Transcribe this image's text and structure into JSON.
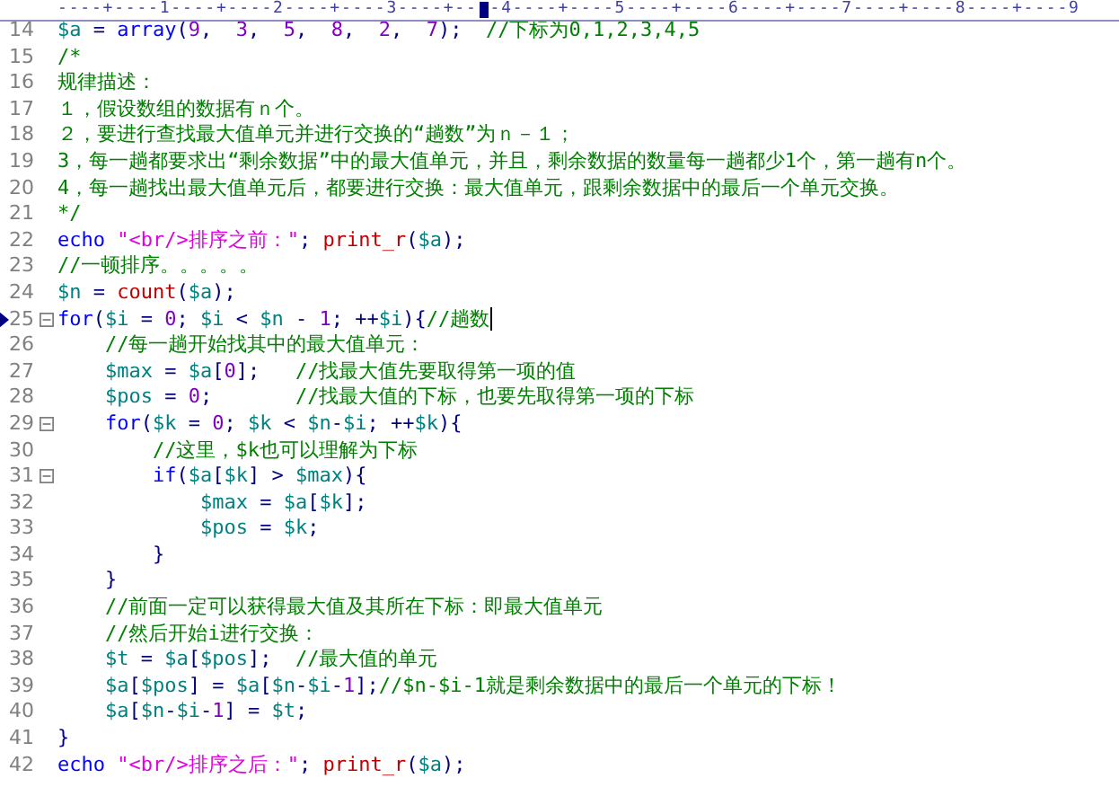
{
  "ruler": {
    "left": "----+----1----+----2----+----3----+--",
    "right": "-4----+----5----+----6----+----7----+----8----+----9"
  },
  "lines": [
    {
      "number": "14",
      "fold": false,
      "bookmark": false,
      "caret": false,
      "tokens": [
        {
          "kind": "var",
          "text": "$a"
        },
        {
          "kind": "op",
          "text": " = "
        },
        {
          "kind": "kw",
          "text": "array"
        },
        {
          "kind": "op",
          "text": "("
        },
        {
          "kind": "num",
          "text": "9"
        },
        {
          "kind": "op",
          "text": ",  "
        },
        {
          "kind": "num",
          "text": "3"
        },
        {
          "kind": "op",
          "text": ",  "
        },
        {
          "kind": "num",
          "text": "5"
        },
        {
          "kind": "op",
          "text": ",  "
        },
        {
          "kind": "num",
          "text": "8"
        },
        {
          "kind": "op",
          "text": ",  "
        },
        {
          "kind": "num",
          "text": "2"
        },
        {
          "kind": "op",
          "text": ",  "
        },
        {
          "kind": "num",
          "text": "7"
        },
        {
          "kind": "op",
          "text": ");  "
        },
        {
          "kind": "cmt",
          "text": "//下标为0,1,2,3,4,5"
        }
      ]
    },
    {
      "number": "15",
      "fold": false,
      "bookmark": false,
      "caret": false,
      "tokens": [
        {
          "kind": "cmt",
          "text": "/*"
        }
      ]
    },
    {
      "number": "16",
      "fold": false,
      "bookmark": false,
      "caret": false,
      "tokens": [
        {
          "kind": "cmt",
          "text": "规律描述："
        }
      ]
    },
    {
      "number": "17",
      "fold": false,
      "bookmark": false,
      "caret": false,
      "tokens": [
        {
          "kind": "cmt",
          "text": "１，假设数组的数据有ｎ个。"
        }
      ]
    },
    {
      "number": "18",
      "fold": false,
      "bookmark": false,
      "caret": false,
      "tokens": [
        {
          "kind": "cmt",
          "text": "２，要进行查找最大值单元并进行交换的“趟数”为ｎ－１；"
        }
      ]
    },
    {
      "number": "19",
      "fold": false,
      "bookmark": false,
      "caret": false,
      "tokens": [
        {
          "kind": "cmt",
          "text": "3，每一趟都要求出“剩余数据”中的最大值单元，并且，剩余数据的数量每一趟都少1个，第一趟有n个。"
        }
      ]
    },
    {
      "number": "20",
      "fold": false,
      "bookmark": false,
      "caret": false,
      "tokens": [
        {
          "kind": "cmt",
          "text": "4，每一趟找出最大值单元后，都要进行交换：最大值单元，跟剩余数据中的最后一个单元交换。"
        }
      ]
    },
    {
      "number": "21",
      "fold": false,
      "bookmark": false,
      "caret": false,
      "tokens": [
        {
          "kind": "cmt",
          "text": "*/"
        }
      ]
    },
    {
      "number": "22",
      "fold": false,
      "bookmark": false,
      "caret": false,
      "tokens": [
        {
          "kind": "kw",
          "text": "echo "
        },
        {
          "kind": "str",
          "text": "\"<br/>排序之前：\""
        },
        {
          "kind": "op",
          "text": "; "
        },
        {
          "kind": "fn",
          "text": "print_r"
        },
        {
          "kind": "op",
          "text": "("
        },
        {
          "kind": "var",
          "text": "$a"
        },
        {
          "kind": "op",
          "text": ");"
        }
      ]
    },
    {
      "number": "23",
      "fold": false,
      "bookmark": false,
      "caret": false,
      "tokens": [
        {
          "kind": "cmt",
          "text": "//一顿排序。。。。。"
        }
      ]
    },
    {
      "number": "24",
      "fold": false,
      "bookmark": false,
      "caret": false,
      "tokens": [
        {
          "kind": "var",
          "text": "$n"
        },
        {
          "kind": "op",
          "text": " = "
        },
        {
          "kind": "fn",
          "text": "count"
        },
        {
          "kind": "op",
          "text": "("
        },
        {
          "kind": "var",
          "text": "$a"
        },
        {
          "kind": "op",
          "text": ");"
        }
      ]
    },
    {
      "number": "25",
      "fold": true,
      "bookmark": true,
      "caret": true,
      "tokens": [
        {
          "kind": "kw",
          "text": "for"
        },
        {
          "kind": "op",
          "text": "("
        },
        {
          "kind": "var",
          "text": "$i"
        },
        {
          "kind": "op",
          "text": " = "
        },
        {
          "kind": "num",
          "text": "0"
        },
        {
          "kind": "op",
          "text": "; "
        },
        {
          "kind": "var",
          "text": "$i"
        },
        {
          "kind": "op",
          "text": " < "
        },
        {
          "kind": "var",
          "text": "$n"
        },
        {
          "kind": "op",
          "text": " - "
        },
        {
          "kind": "num",
          "text": "1"
        },
        {
          "kind": "op",
          "text": "; ++"
        },
        {
          "kind": "var",
          "text": "$i"
        },
        {
          "kind": "op",
          "text": "){"
        },
        {
          "kind": "cmt",
          "text": "//趟数"
        }
      ]
    },
    {
      "number": "26",
      "fold": false,
      "bookmark": false,
      "caret": false,
      "tokens": [
        {
          "kind": "cmt",
          "text": "    //每一趟开始找其中的最大值单元："
        }
      ]
    },
    {
      "number": "27",
      "fold": false,
      "bookmark": false,
      "caret": false,
      "tokens": [
        {
          "kind": "var",
          "text": "    $max"
        },
        {
          "kind": "op",
          "text": " = "
        },
        {
          "kind": "var",
          "text": "$a"
        },
        {
          "kind": "op",
          "text": "["
        },
        {
          "kind": "num",
          "text": "0"
        },
        {
          "kind": "op",
          "text": "];   "
        },
        {
          "kind": "cmt",
          "text": "//找最大值先要取得第一项的值"
        }
      ]
    },
    {
      "number": "28",
      "fold": false,
      "bookmark": false,
      "caret": false,
      "tokens": [
        {
          "kind": "var",
          "text": "    $pos"
        },
        {
          "kind": "op",
          "text": " = "
        },
        {
          "kind": "num",
          "text": "0"
        },
        {
          "kind": "op",
          "text": ";       "
        },
        {
          "kind": "cmt",
          "text": "//找最大值的下标，也要先取得第一项的下标"
        }
      ]
    },
    {
      "number": "29",
      "fold": true,
      "bookmark": false,
      "caret": false,
      "tokens": [
        {
          "kind": "kw",
          "text": "    for"
        },
        {
          "kind": "op",
          "text": "("
        },
        {
          "kind": "var",
          "text": "$k"
        },
        {
          "kind": "op",
          "text": " = "
        },
        {
          "kind": "num",
          "text": "0"
        },
        {
          "kind": "op",
          "text": "; "
        },
        {
          "kind": "var",
          "text": "$k"
        },
        {
          "kind": "op",
          "text": " < "
        },
        {
          "kind": "var",
          "text": "$n"
        },
        {
          "kind": "op",
          "text": "-"
        },
        {
          "kind": "var",
          "text": "$i"
        },
        {
          "kind": "op",
          "text": "; ++"
        },
        {
          "kind": "var",
          "text": "$k"
        },
        {
          "kind": "op",
          "text": "){"
        }
      ]
    },
    {
      "number": "30",
      "fold": false,
      "bookmark": false,
      "caret": false,
      "tokens": [
        {
          "kind": "cmt",
          "text": "        //这里，$k也可以理解为下标"
        }
      ]
    },
    {
      "number": "31",
      "fold": true,
      "bookmark": false,
      "caret": false,
      "tokens": [
        {
          "kind": "kw",
          "text": "        if"
        },
        {
          "kind": "op",
          "text": "("
        },
        {
          "kind": "var",
          "text": "$a"
        },
        {
          "kind": "op",
          "text": "["
        },
        {
          "kind": "var",
          "text": "$k"
        },
        {
          "kind": "op",
          "text": "] > "
        },
        {
          "kind": "var",
          "text": "$max"
        },
        {
          "kind": "op",
          "text": "){"
        }
      ]
    },
    {
      "number": "32",
      "fold": false,
      "bookmark": false,
      "caret": false,
      "tokens": [
        {
          "kind": "var",
          "text": "            $max"
        },
        {
          "kind": "op",
          "text": " = "
        },
        {
          "kind": "var",
          "text": "$a"
        },
        {
          "kind": "op",
          "text": "["
        },
        {
          "kind": "var",
          "text": "$k"
        },
        {
          "kind": "op",
          "text": "];"
        }
      ]
    },
    {
      "number": "33",
      "fold": false,
      "bookmark": false,
      "caret": false,
      "tokens": [
        {
          "kind": "var",
          "text": "            $pos"
        },
        {
          "kind": "op",
          "text": " = "
        },
        {
          "kind": "var",
          "text": "$k"
        },
        {
          "kind": "op",
          "text": ";"
        }
      ]
    },
    {
      "number": "34",
      "fold": false,
      "bookmark": false,
      "caret": false,
      "tokens": [
        {
          "kind": "op",
          "text": "        }"
        }
      ]
    },
    {
      "number": "35",
      "fold": false,
      "bookmark": false,
      "caret": false,
      "tokens": [
        {
          "kind": "op",
          "text": "    }"
        }
      ]
    },
    {
      "number": "36",
      "fold": false,
      "bookmark": false,
      "caret": false,
      "tokens": [
        {
          "kind": "cmt",
          "text": "    //前面一定可以获得最大值及其所在下标：即最大值单元"
        }
      ]
    },
    {
      "number": "37",
      "fold": false,
      "bookmark": false,
      "caret": false,
      "tokens": [
        {
          "kind": "cmt",
          "text": "    //然后开始i进行交换："
        }
      ]
    },
    {
      "number": "38",
      "fold": false,
      "bookmark": false,
      "caret": false,
      "tokens": [
        {
          "kind": "var",
          "text": "    $t"
        },
        {
          "kind": "op",
          "text": " = "
        },
        {
          "kind": "var",
          "text": "$a"
        },
        {
          "kind": "op",
          "text": "["
        },
        {
          "kind": "var",
          "text": "$pos"
        },
        {
          "kind": "op",
          "text": "];  "
        },
        {
          "kind": "cmt",
          "text": "//最大值的单元"
        }
      ]
    },
    {
      "number": "39",
      "fold": false,
      "bookmark": false,
      "caret": false,
      "tokens": [
        {
          "kind": "var",
          "text": "    $a"
        },
        {
          "kind": "op",
          "text": "["
        },
        {
          "kind": "var",
          "text": "$pos"
        },
        {
          "kind": "op",
          "text": "] = "
        },
        {
          "kind": "var",
          "text": "$a"
        },
        {
          "kind": "op",
          "text": "["
        },
        {
          "kind": "var",
          "text": "$n"
        },
        {
          "kind": "op",
          "text": "-"
        },
        {
          "kind": "var",
          "text": "$i"
        },
        {
          "kind": "op",
          "text": "-"
        },
        {
          "kind": "num",
          "text": "1"
        },
        {
          "kind": "op",
          "text": "];"
        },
        {
          "kind": "cmt",
          "text": "//$n-$i-1就是剩余数据中的最后一个单元的下标！"
        }
      ]
    },
    {
      "number": "40",
      "fold": false,
      "bookmark": false,
      "caret": false,
      "tokens": [
        {
          "kind": "var",
          "text": "    $a"
        },
        {
          "kind": "op",
          "text": "["
        },
        {
          "kind": "var",
          "text": "$n"
        },
        {
          "kind": "op",
          "text": "-"
        },
        {
          "kind": "var",
          "text": "$i"
        },
        {
          "kind": "op",
          "text": "-"
        },
        {
          "kind": "num",
          "text": "1"
        },
        {
          "kind": "op",
          "text": "] = "
        },
        {
          "kind": "var",
          "text": "$t"
        },
        {
          "kind": "op",
          "text": ";"
        }
      ]
    },
    {
      "number": "41",
      "fold": false,
      "bookmark": false,
      "caret": false,
      "tokens": [
        {
          "kind": "op",
          "text": "}"
        }
      ]
    },
    {
      "number": "42",
      "fold": false,
      "bookmark": false,
      "caret": false,
      "tokens": [
        {
          "kind": "kw",
          "text": "echo "
        },
        {
          "kind": "str",
          "text": "\"<br/>排序之后：\""
        },
        {
          "kind": "op",
          "text": "; "
        },
        {
          "kind": "fn",
          "text": "print_r"
        },
        {
          "kind": "op",
          "text": "("
        },
        {
          "kind": "var",
          "text": "$a"
        },
        {
          "kind": "op",
          "text": ");"
        }
      ]
    }
  ]
}
